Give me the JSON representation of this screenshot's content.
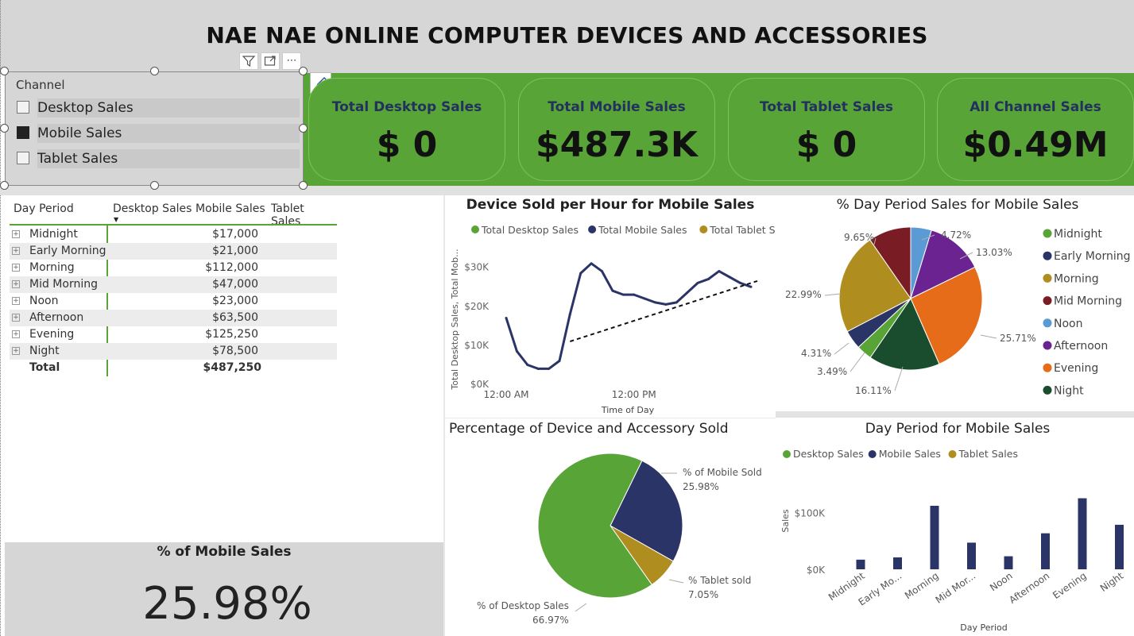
{
  "header": {
    "title": "NAE NAE ONLINE COMPUTER DEVICES AND ACCESSORIES"
  },
  "slicer": {
    "title": "Channel",
    "items": [
      {
        "label": "Desktop Sales",
        "checked": false
      },
      {
        "label": "Mobile Sales",
        "checked": true
      },
      {
        "label": "Tablet Sales",
        "checked": false
      }
    ]
  },
  "toolbar": {
    "filter_icon": "filter-icon",
    "focus_icon": "focus-mode-icon",
    "more_icon": "more-options-icon",
    "format_icon": "format-brush-icon"
  },
  "cards": [
    {
      "label": "Total Desktop Sales",
      "value": "$ 0"
    },
    {
      "label": "Total Mobile Sales",
      "value": "$487.3K"
    },
    {
      "label": "Total Tablet Sales",
      "value": "$ 0"
    },
    {
      "label": "All Channel Sales",
      "value": "$0.49M"
    }
  ],
  "table": {
    "headers": [
      "Day Period",
      "Desktop Sales",
      "Mobile Sales",
      "Tablet Sales"
    ],
    "rows": [
      {
        "period": "Midnight",
        "mobile": "$17,000"
      },
      {
        "period": "Early Morning",
        "mobile": "$21,000"
      },
      {
        "period": "Morning",
        "mobile": "$112,000"
      },
      {
        "period": "Mid Morning",
        "mobile": "$47,000"
      },
      {
        "period": "Noon",
        "mobile": "$23,000"
      },
      {
        "period": "Afternoon",
        "mobile": "$63,500"
      },
      {
        "period": "Evening",
        "mobile": "$125,250"
      },
      {
        "period": "Night",
        "mobile": "$78,500"
      }
    ],
    "total": {
      "label": "Total",
      "mobile": "$487,250"
    }
  },
  "mobile_pct": {
    "label": "% of Mobile Sales",
    "value": "25.98%"
  },
  "colors": {
    "green": "#59a437",
    "navy": "#2b3467",
    "gold": "#b08d1f",
    "maroon": "#7a1c23",
    "lightblue": "#5b9bd5",
    "purple": "#6a2391",
    "orange": "#e66c1a",
    "darkgreen": "#1a4d2e"
  },
  "chart_data": [
    {
      "type": "line",
      "title": "Device Sold per Hour for Mobile Sales",
      "xlabel": "Time of Day",
      "ylabel": "Total Desktop Sales, Total Mob...",
      "legend": [
        "Total Desktop Sales",
        "Total Mobile Sales",
        "Total Tablet Sales"
      ],
      "x_ticks": [
        "12:00 AM",
        "12:00 PM"
      ],
      "y_ticks": [
        "$0K",
        "$10K",
        "$20K",
        "$30K"
      ],
      "ylim": [
        0,
        33000
      ],
      "series": [
        {
          "name": "Total Mobile Sales",
          "values": [
            17000,
            8500,
            5000,
            4000,
            4000,
            6000,
            18000,
            28500,
            31000,
            29000,
            24000,
            23000,
            23000,
            22000,
            21000,
            20500,
            21000,
            23500,
            26000,
            27000,
            29000,
            27500,
            26000,
            25000
          ]
        }
      ],
      "trendline": true
    },
    {
      "type": "pie",
      "title": "% Day Period Sales for Mobile Sales",
      "legend_position": "right",
      "slices": [
        {
          "label": "Midnight",
          "value": 3.49
        },
        {
          "label": "Early Morning",
          "value": 4.31
        },
        {
          "label": "Morning",
          "value": 22.99
        },
        {
          "label": "Mid Morning",
          "value": 9.65
        },
        {
          "label": "Noon",
          "value": 4.72
        },
        {
          "label": "Afternoon",
          "value": 13.03
        },
        {
          "label": "Evening",
          "value": 25.71
        },
        {
          "label": "Night",
          "value": 16.11
        }
      ]
    },
    {
      "type": "pie",
      "title": "Percentage of Device and Accessory Sold",
      "slices": [
        {
          "label": "% of Mobile Sold",
          "value": 25.98
        },
        {
          "label": "% Tablet sold",
          "value": 7.05
        },
        {
          "label": "% of Desktop Sales",
          "value": 66.97
        }
      ]
    },
    {
      "type": "bar",
      "title": "Day Period for Mobile Sales",
      "xlabel": "Day Period",
      "ylabel": "Sales",
      "legend": [
        "Desktop Sales",
        "Mobile Sales",
        "Tablet Sales"
      ],
      "categories": [
        "Midnight",
        "Early Mo...",
        "Morning",
        "Mid Mor...",
        "Noon",
        "Afternoon",
        "Evening",
        "Night"
      ],
      "series": [
        {
          "name": "Mobile Sales",
          "values": [
            17000,
            21000,
            112000,
            47000,
            23000,
            63500,
            125250,
            78500
          ]
        }
      ],
      "y_ticks": [
        "$0K",
        "$100K"
      ],
      "ylim": [
        0,
        140000
      ]
    }
  ]
}
